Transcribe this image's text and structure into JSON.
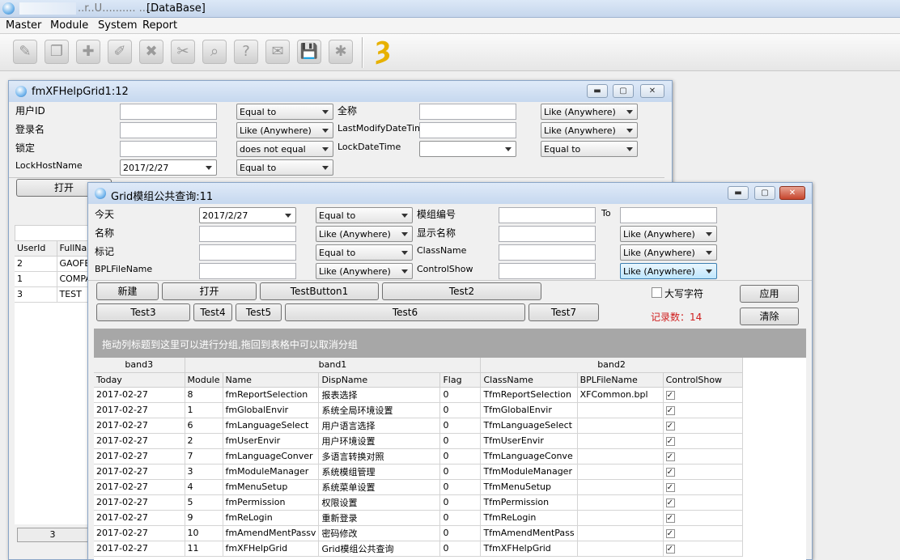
{
  "app": {
    "title": "        ...... ......... ...... [DataBase]",
    "title_suffix": "[DataBase]",
    "menu": [
      "Master",
      "Module",
      "System",
      "Report"
    ]
  },
  "toolbar": {
    "icons": [
      "wizard-icon",
      "copy-icon",
      "new-doc-icon",
      "edit-icon",
      "delete-icon",
      "cut-icon",
      "search-icon",
      "help-icon",
      "scroll-icon",
      "save-disk-icon",
      "settings-icon"
    ],
    "glyphs": [
      "✎",
      "❐",
      "✚",
      "✐",
      "✖",
      "✂",
      "⌕",
      "?",
      "✉",
      "💾",
      "✱"
    ],
    "run_icon": "running-man-icon",
    "run_glyph": "Ȝ",
    "accent": "#e7b100"
  },
  "win1": {
    "title": "fmXFHelpGrid1:12",
    "labels": [
      "用户ID",
      "登录名",
      "锁定",
      "LockHostName",
      "全称",
      "LastModifyDateTime",
      "LockDateTime"
    ],
    "date_value": "2017/2/27",
    "ops": [
      "Equal to",
      "Like (Anywhere)",
      "does not equal",
      "Equal to",
      "Like (Anywhere)",
      "Like (Anywhere)",
      "Equal to"
    ],
    "open_button": "打开",
    "grid_headers": [
      "UserId",
      "FullNam"
    ],
    "rows": [
      {
        "id": "2",
        "name": "GAOFEN"
      },
      {
        "id": "1",
        "name": "COMPA"
      },
      {
        "id": "3",
        "name": "TEST"
      }
    ],
    "footer_count": "3"
  },
  "win2": {
    "title": "Grid模组公共查询:11",
    "labels": [
      "今天",
      "名称",
      "标记",
      "BPLFileName",
      "模组编号",
      "显示名称",
      "ClassName",
      "ControlShow",
      "To"
    ],
    "date_value": "2017/2/27",
    "ops_left": [
      "Equal to",
      "Like (Anywhere)",
      "Equal to",
      "Like (Anywhere)"
    ],
    "ops_right": [
      "Like (Anywhere)",
      "Like (Anywhere)",
      "Like (Anywhere)"
    ],
    "buttons_row1": [
      "新建",
      "打开",
      "TestButton1",
      "Test2"
    ],
    "buttons_row2": [
      "Test3",
      "Test4",
      "Test5",
      "Test6",
      "Test7"
    ],
    "uppercase_label": "大写字符",
    "apply_button": "应用",
    "clear_button": "清除",
    "record_count": "记录数：14",
    "group_hint": "拖动列标题到这里可以进行分组,拖回到表格中可以取消分组",
    "bands": [
      "band3",
      "band1",
      "band2"
    ],
    "columns": [
      "Today",
      "Module",
      "Name",
      "DispName",
      "Flag",
      "ClassName",
      "BPLFileName",
      "ControlShow"
    ],
    "rows": [
      [
        "2017-02-27",
        "8",
        "fmReportSelection",
        "报表选择",
        "0",
        "TfmReportSelection",
        "XFCommon.bpl",
        "✓"
      ],
      [
        "2017-02-27",
        "1",
        "fmGlobalEnvir",
        "系统全局环境设置",
        "0",
        "TfmGlobalEnvir",
        "",
        "✓"
      ],
      [
        "2017-02-27",
        "6",
        "fmLanguageSelect",
        "用户语言选择",
        "0",
        "TfmLanguageSelect",
        "",
        "✓"
      ],
      [
        "2017-02-27",
        "2",
        "fmUserEnvir",
        "用户环境设置",
        "0",
        "TfmUserEnvir",
        "",
        "✓"
      ],
      [
        "2017-02-27",
        "7",
        "fmLanguageConver",
        "多语言转换对照",
        "0",
        "TfmLanguageConve",
        "",
        "✓"
      ],
      [
        "2017-02-27",
        "3",
        "fmModuleManager",
        "系统模组管理",
        "0",
        "TfmModuleManager",
        "",
        "✓"
      ],
      [
        "2017-02-27",
        "4",
        "fmMenuSetup",
        "系统菜单设置",
        "0",
        "TfmMenuSetup",
        "",
        "✓"
      ],
      [
        "2017-02-27",
        "5",
        "fmPermission",
        "权限设置",
        "0",
        "TfmPermission",
        "",
        "✓"
      ],
      [
        "2017-02-27",
        "9",
        "fmReLogin",
        "重新登录",
        "0",
        "TfmReLogin",
        "",
        "✓"
      ],
      [
        "2017-02-27",
        "10",
        "fmAmendMentPassv",
        "密码修改",
        "0",
        "TfmAmendMentPass",
        "",
        "✓"
      ],
      [
        "2017-02-27",
        "11",
        "fmXFHelpGrid",
        "Grid模组公共查询",
        "0",
        "TfmXFHelpGrid",
        "",
        "✓"
      ]
    ]
  }
}
